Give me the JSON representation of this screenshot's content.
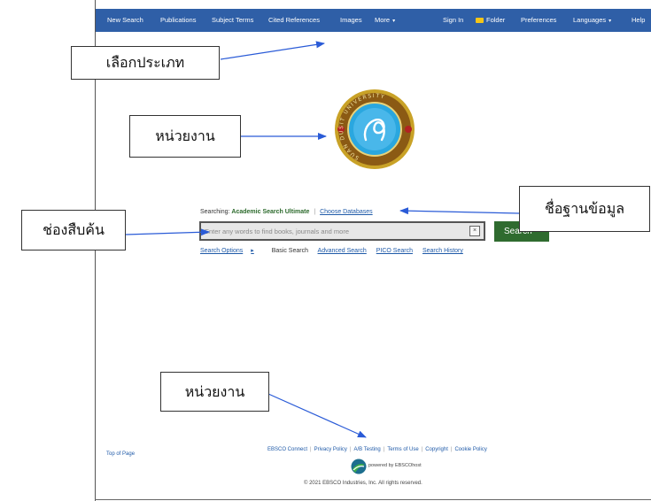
{
  "nav": {
    "new_search": "New Search",
    "publications": "Publications",
    "subject_terms": "Subject Terms",
    "cited_references": "Cited References",
    "images": "Images",
    "more": "More",
    "sign_in": "Sign In",
    "folder": "Folder",
    "preferences": "Preferences",
    "languages": "Languages",
    "help": "Help"
  },
  "search": {
    "searching_label": "Searching:",
    "database": "Academic Search Ultimate",
    "choose_databases": "Choose Databases",
    "placeholder": "Enter any words to find books, journals and more",
    "clear_symbol": "×",
    "button": "Search",
    "options": "Search Options",
    "options_arrow": "▸",
    "basic": "Basic Search",
    "advanced": "Advanced Search",
    "pico": "PICO Search",
    "history": "Search History"
  },
  "seal": {
    "text": "SUAN DUSIT UNIVERSITY"
  },
  "footer": {
    "top_of_page": "Top of Page",
    "links": [
      "EBSCO Connect",
      "Privacy Policy",
      "A/B Testing",
      "Terms of Use",
      "Copyright",
      "Cookie Policy"
    ],
    "powered_by": "powered by EBSCOhost",
    "copyright": "© 2021 EBSCO Industries, Inc. All rights reserved."
  },
  "callouts": {
    "category": "เลือกประเภท",
    "institution_top": "หน่วยงาน",
    "database_name": "ชื่อฐานข้อมูล",
    "search_box": "ช่องสืบค้น",
    "institution_bottom": "หน่วยงาน"
  },
  "colors": {
    "nav_bar": "#2f5fa7",
    "search_button": "#2f6b2f",
    "link": "#1f5aa8",
    "arrow": "#2a5bd7"
  }
}
